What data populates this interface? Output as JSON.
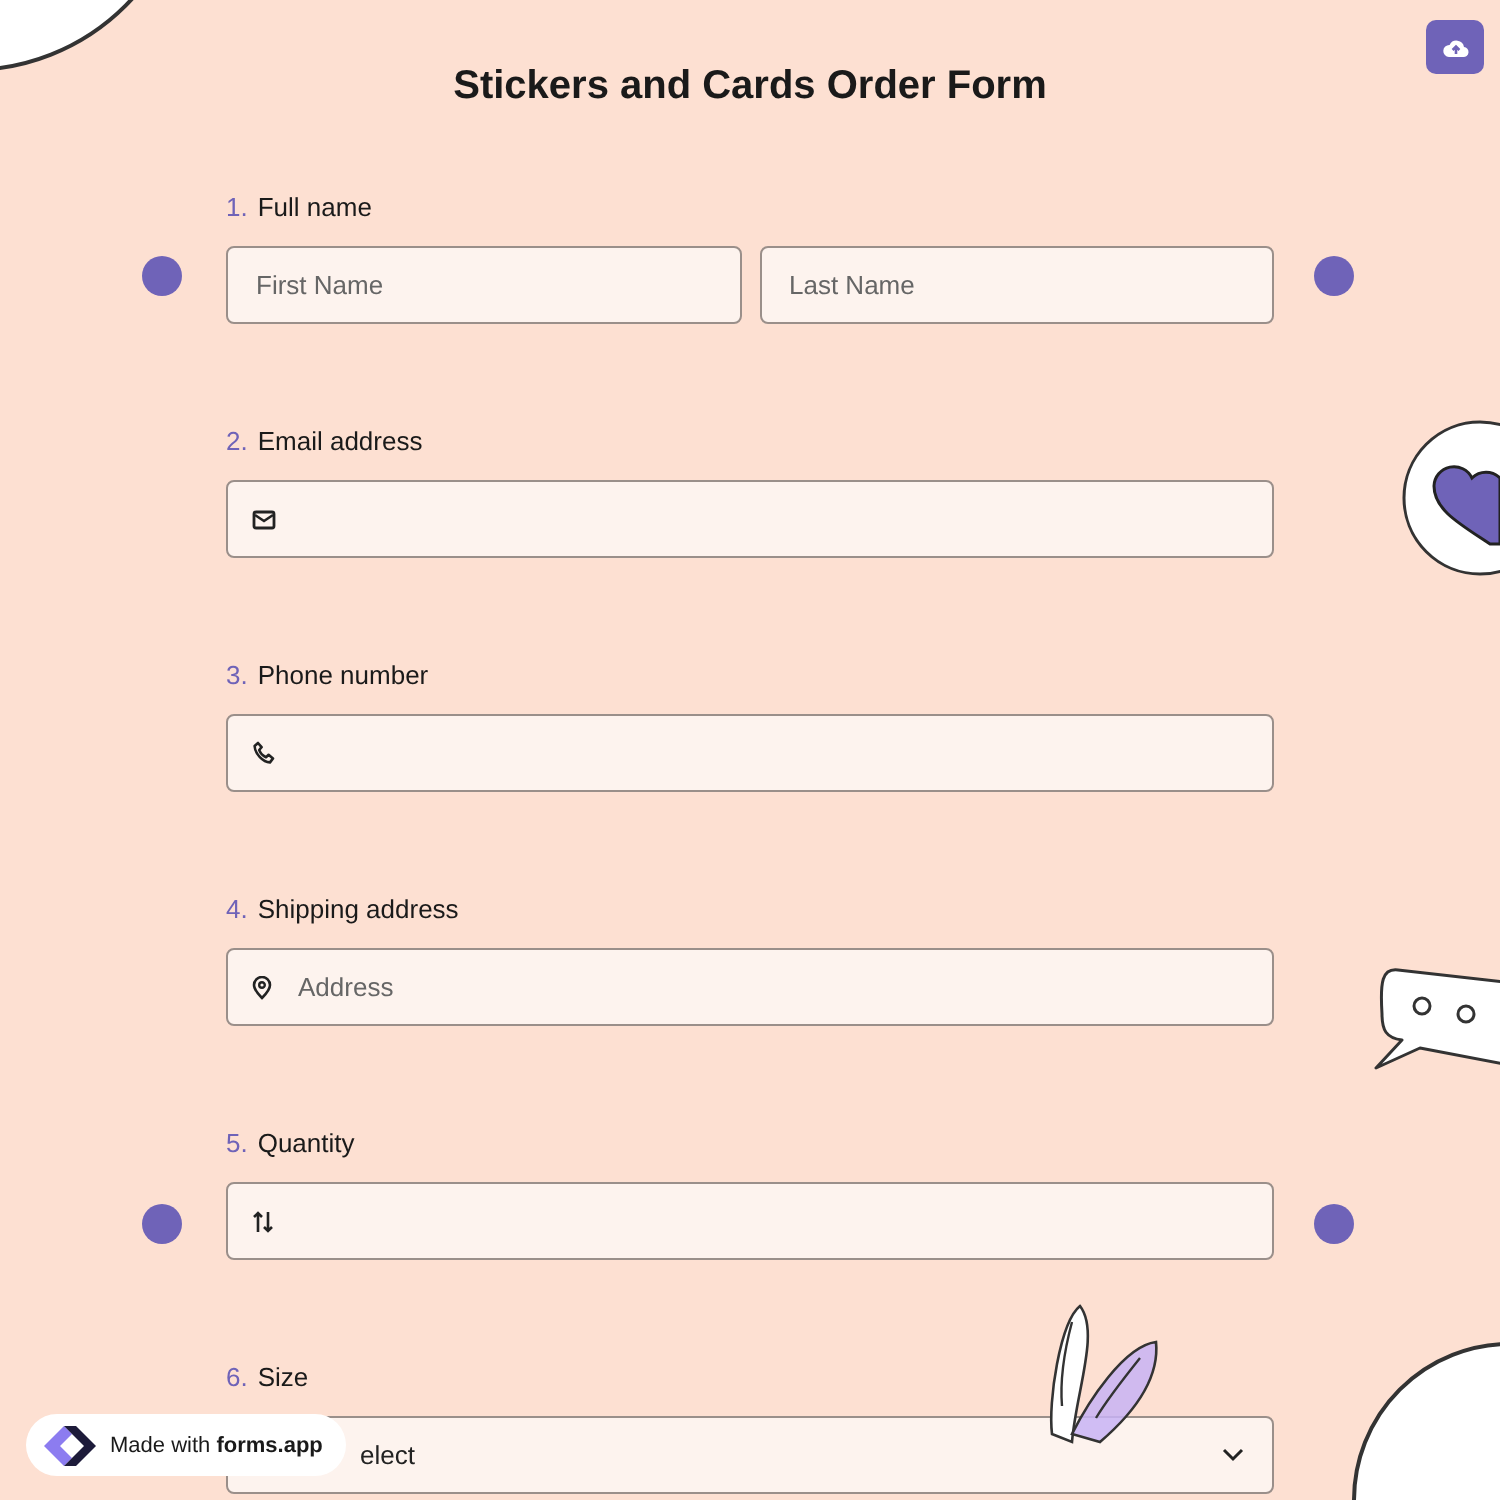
{
  "title": "Stickers and Cards Order Form",
  "questions": [
    {
      "number": "1.",
      "label": "Full name",
      "kind": "name",
      "fields": [
        {
          "placeholder": "First Name"
        },
        {
          "placeholder": "Last Name"
        }
      ]
    },
    {
      "number": "2.",
      "label": "Email address",
      "kind": "email"
    },
    {
      "number": "3.",
      "label": "Phone number",
      "kind": "phone"
    },
    {
      "number": "4.",
      "label": "Shipping address",
      "kind": "address",
      "fields": [
        {
          "placeholder": "Address"
        }
      ]
    },
    {
      "number": "5.",
      "label": "Quantity",
      "kind": "number"
    },
    {
      "number": "6.",
      "label": "Size",
      "kind": "select",
      "fields": [
        {
          "value": "elect"
        }
      ]
    }
  ],
  "badge": "Made with **forms.app**"
}
